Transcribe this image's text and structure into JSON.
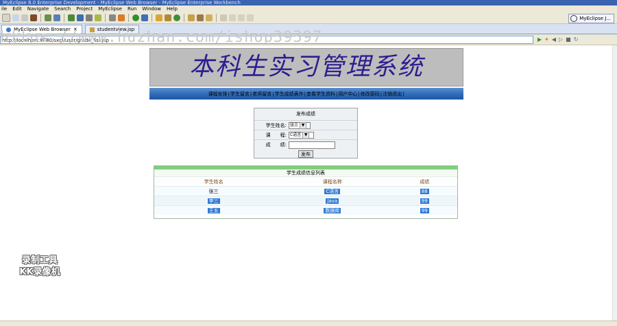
{
  "window": {
    "title": "MyEclipse 8.0 Enterprise Development - MyEclipse Web Browser - MyEclipse Enterprise Workbench"
  },
  "menu": [
    "ile",
    "Edit",
    "Navigate",
    "Search",
    "Project",
    "MyEclipse",
    "Run",
    "Window",
    "Help"
  ],
  "perspective_label": "MyEclipse J...",
  "tabs": [
    {
      "label": "MyEclipse Web Browser",
      "active": true
    },
    {
      "label": "studentview.jsp",
      "active": false
    }
  ],
  "address": "http://localhost:8080/sxgl/user/grade_list.jsp",
  "page": {
    "banner_title": "本科生实习管理系统",
    "nav": [
      "课程安排",
      "学生留言",
      "老师留言",
      "学生成绩表作",
      "查看学生资料",
      "用户中心",
      "修改密码",
      "注销退出"
    ],
    "form": {
      "title": "发布成绩",
      "student_label": "学生姓名:",
      "student_value": "张三",
      "course_label": "课　　程:",
      "course_value": "C语言",
      "score_label": "成　　绩:",
      "score_value": "",
      "submit_label": "发布"
    },
    "table": {
      "title": "学生成绩信息列表",
      "headers": [
        "学生姓名",
        "课程名称",
        "成绩"
      ],
      "rows": [
        [
          "张三",
          "C语言",
          "88"
        ],
        [
          "李三",
          "Java",
          "99"
        ],
        [
          "王五",
          "数据库",
          "99"
        ]
      ]
    }
  },
  "overlay": {
    "watermark": "https://www.huzhan.com/ishop39397",
    "recorder_line1": "录制工具",
    "recorder_line2": "KK录像机"
  }
}
